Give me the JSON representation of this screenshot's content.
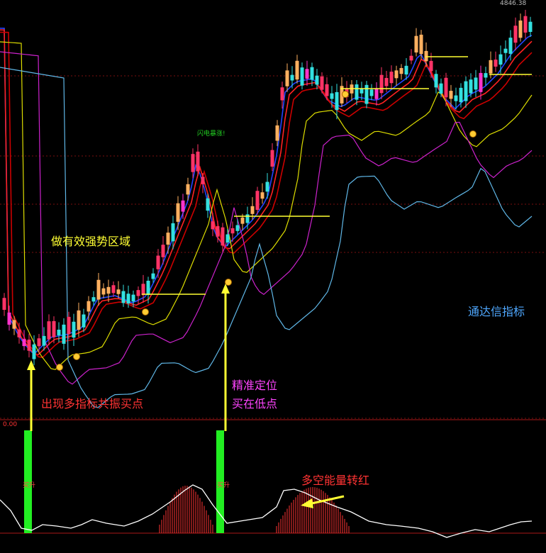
{
  "chart_data": [
    {
      "type": "candlestick",
      "title": "",
      "price_label": "4846.38",
      "signal_label": "闪电暴涨!",
      "ma_colors": [
        "#2244ff",
        "#ff2222",
        "#cc0000",
        "#dddd00",
        "#cc22cc",
        "#5fb6e6"
      ],
      "candle_colors": {
        "up_bright": "#ffb060",
        "up": "#ff3366",
        "down": "#33e0e0",
        "magenta": "#ff33cc"
      },
      "grid": true,
      "annotations": {
        "strong_zone": "做有效强势区域",
        "resonance_buy": "出现多指标共振买点",
        "precise_line1": "精准定位",
        "precise_line2": "买在低点",
        "software": "通达信指标"
      }
    },
    {
      "type": "oscillator",
      "zero_label": "0.00",
      "buy_labels": [
        "买升",
        "买升"
      ],
      "annotation": "多空能量转红",
      "colors": {
        "line": "#ffffff",
        "energy_bars": "#ff3333",
        "buy_bars": "#22ee22"
      }
    }
  ]
}
